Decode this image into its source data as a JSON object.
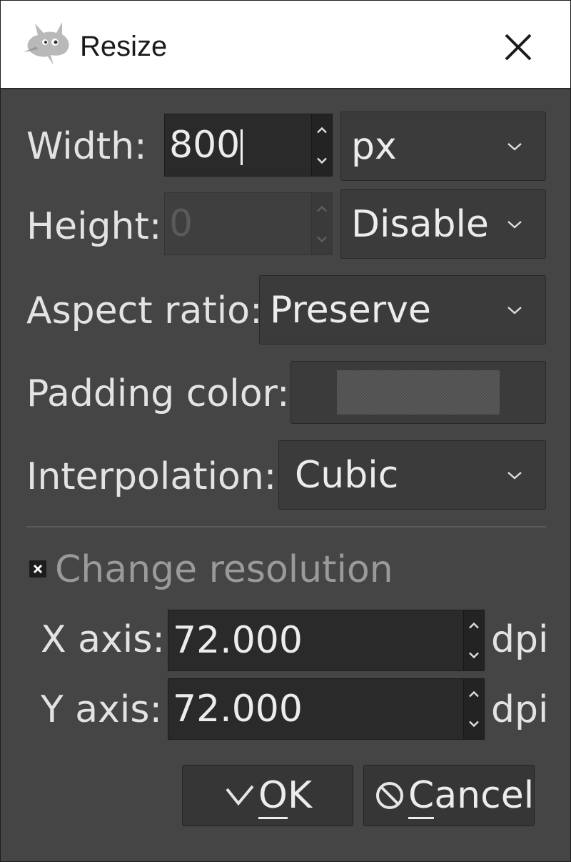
{
  "window": {
    "title": "Resize",
    "app_icon": "wilber-icon",
    "close_icon": "close-icon"
  },
  "size": {
    "width_label": "Width:",
    "width_value": "800",
    "width_unit": "px",
    "height_label": "Height:",
    "height_value": "0",
    "height_mode": "Disable"
  },
  "aspect": {
    "label": "Aspect ratio:",
    "value": "Preserve"
  },
  "padding": {
    "label": "Padding color:",
    "color": "#555555"
  },
  "interpolation": {
    "label": "Interpolation:",
    "value": "Cubic"
  },
  "resolution": {
    "checkbox_label": "Change resolution",
    "checked": true,
    "x_label": "X axis:",
    "x_value": "72.000",
    "x_unit": "dpi",
    "y_label": "Y axis:",
    "y_value": "72.000",
    "y_unit": "dpi"
  },
  "buttons": {
    "ok_mnemonic": "O",
    "ok_rest": "K",
    "cancel_mnemonic": "C",
    "cancel_rest": "ancel"
  },
  "colors": {
    "dialog_bg": "#454545",
    "field_bg": "#2a2a2a",
    "text": "#e6e6e6"
  }
}
